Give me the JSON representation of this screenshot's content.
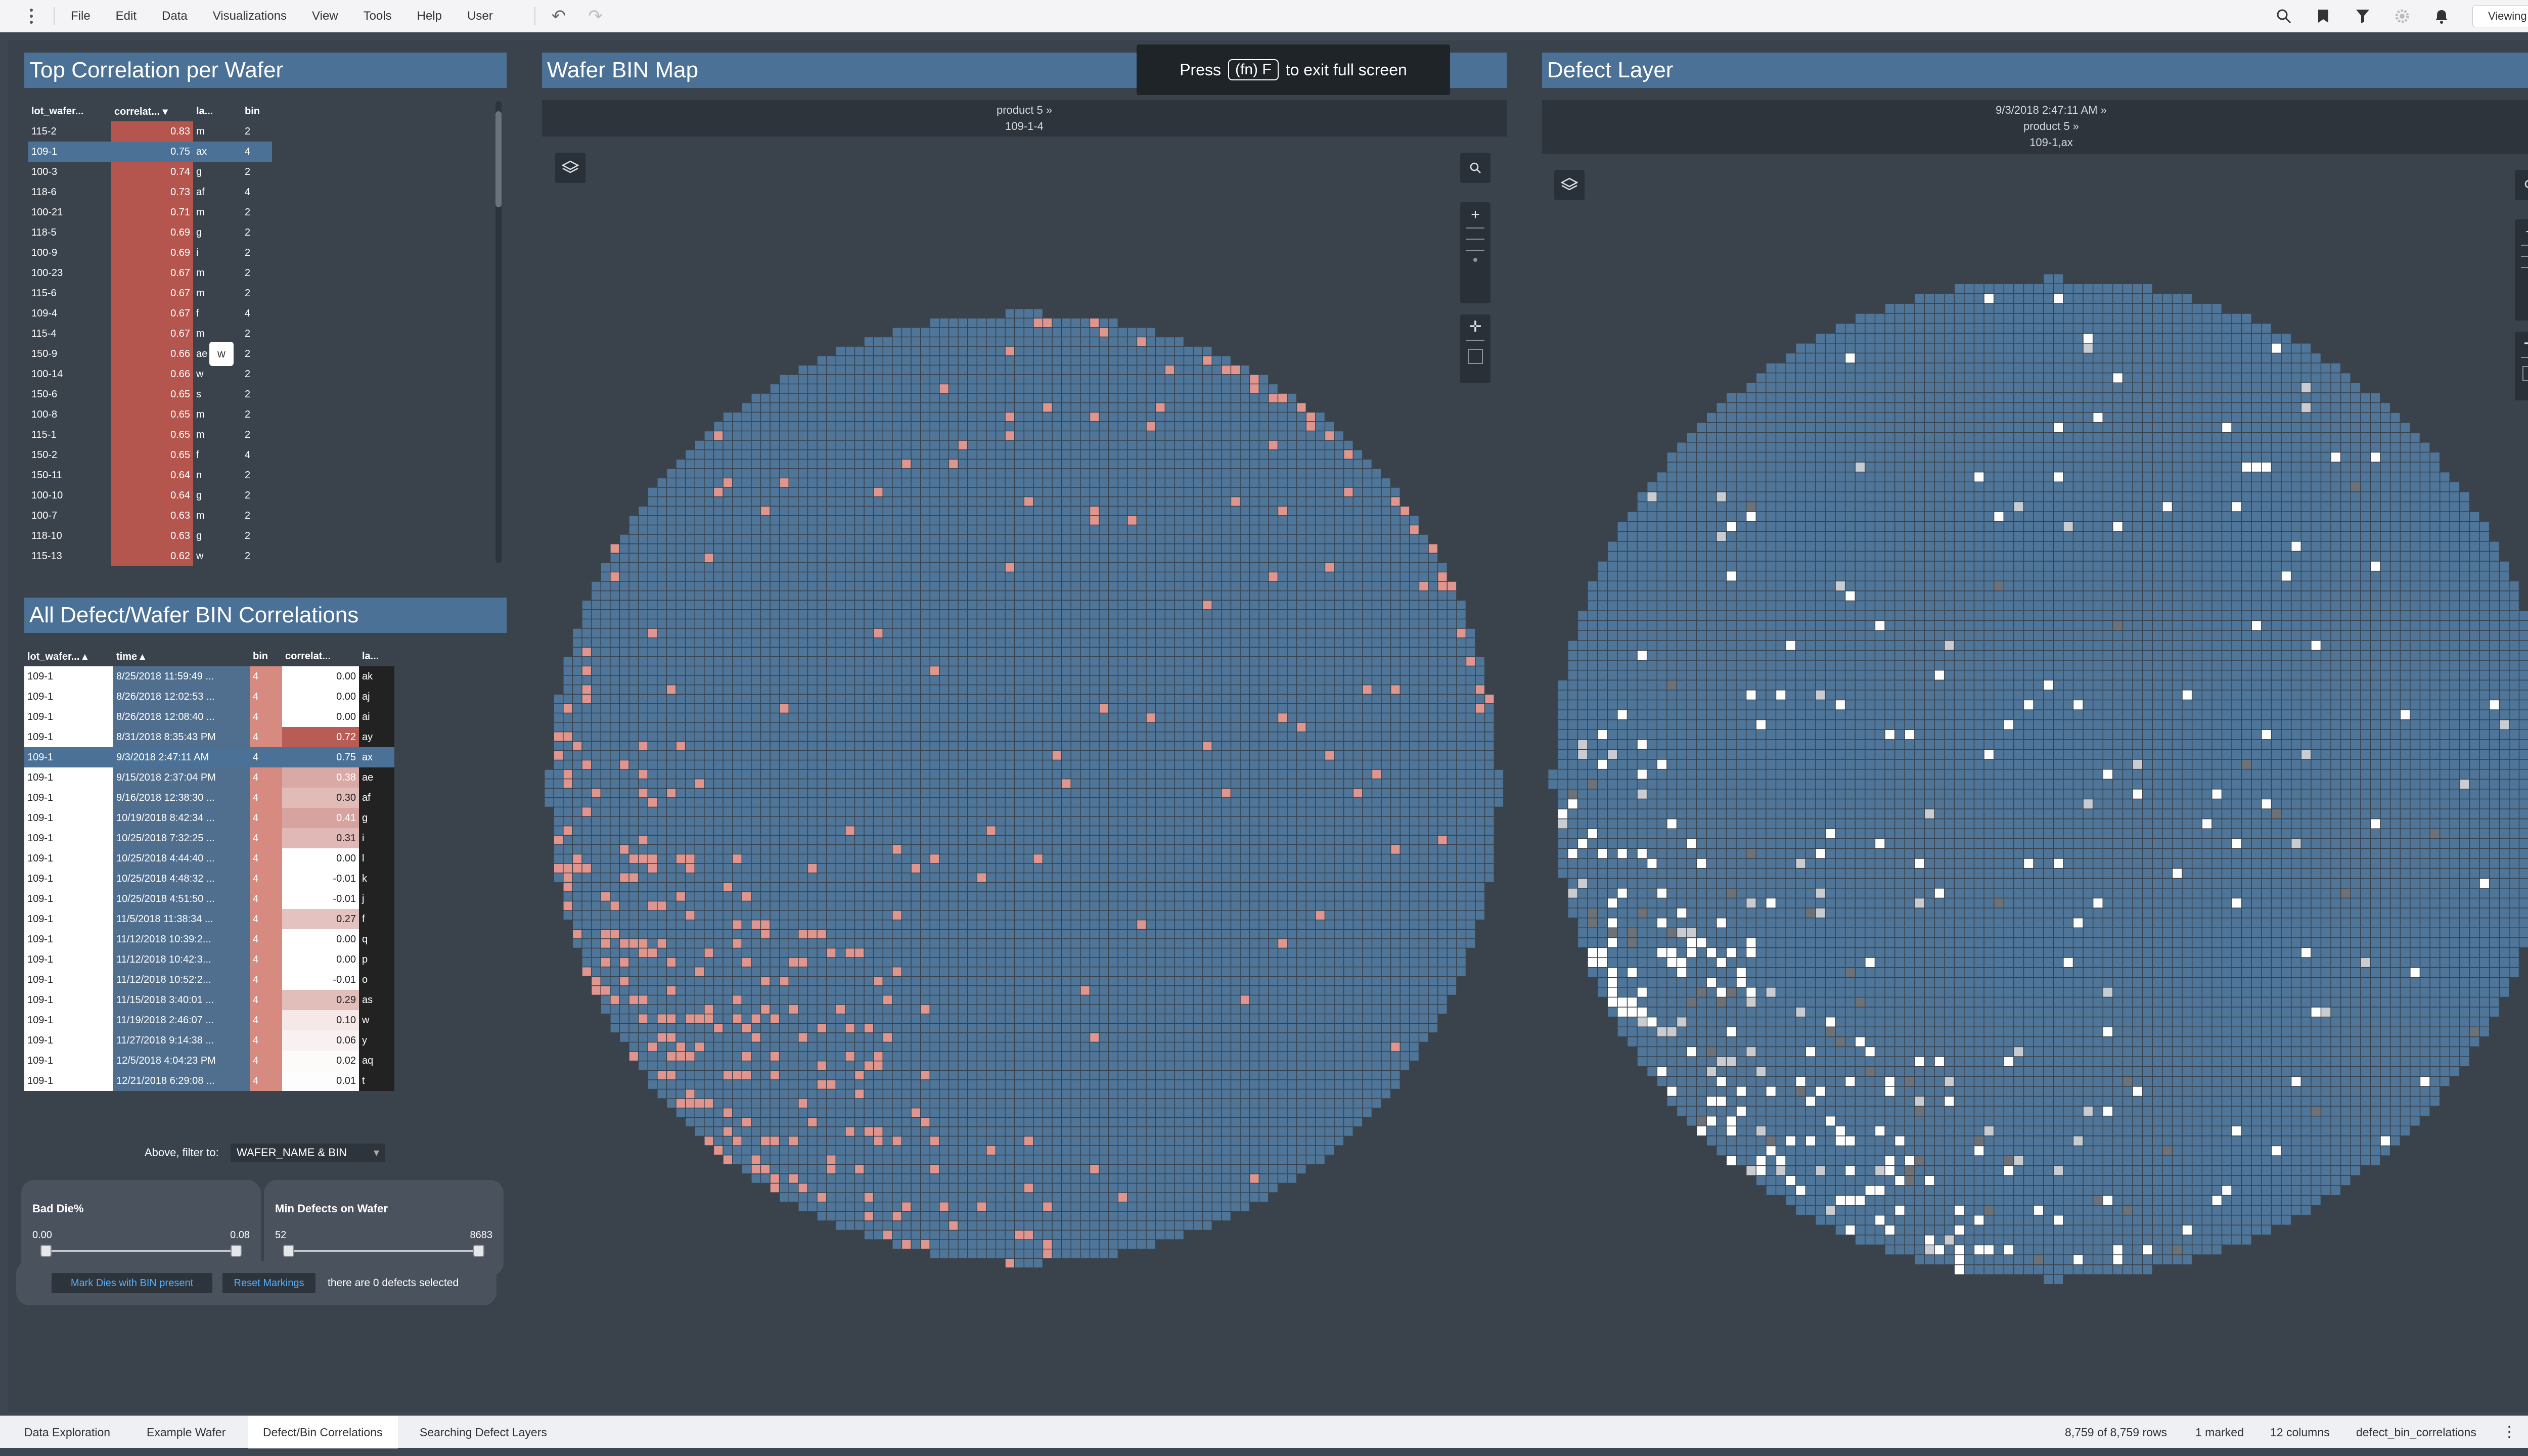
{
  "menu": [
    "File",
    "Edit",
    "Data",
    "Visualizations",
    "View",
    "Tools",
    "Help",
    "User"
  ],
  "mode_label": "Viewing",
  "tooltip": {
    "press": "Press",
    "key": "(fn) F",
    "rest": "to exit full screen"
  },
  "panels": {
    "top_corr_title": "Top Correlation per Wafer",
    "all_corr_title": "All Defect/Wafer BIN Correlations",
    "wafer_bin_title": "Wafer BIN Map",
    "defect_title": "Defect Layer"
  },
  "top_corr": {
    "headers": [
      "lot_wafer...",
      "correlat... ▾",
      "la...",
      "bin"
    ],
    "rows": [
      {
        "lot": "115-2",
        "corr": "0.83",
        "lab": "m",
        "bin": "2"
      },
      {
        "lot": "109-1",
        "corr": "0.75",
        "lab": "ax",
        "bin": "4"
      },
      {
        "lot": "100-3",
        "corr": "0.74",
        "lab": "g",
        "bin": "2"
      },
      {
        "lot": "118-6",
        "corr": "0.73",
        "lab": "af",
        "bin": "4"
      },
      {
        "lot": "100-21",
        "corr": "0.71",
        "lab": "m",
        "bin": "2"
      },
      {
        "lot": "118-5",
        "corr": "0.69",
        "lab": "g",
        "bin": "2"
      },
      {
        "lot": "100-9",
        "corr": "0.69",
        "lab": "i",
        "bin": "2"
      },
      {
        "lot": "100-23",
        "corr": "0.67",
        "lab": "m",
        "bin": "2"
      },
      {
        "lot": "115-6",
        "corr": "0.67",
        "lab": "m",
        "bin": "2"
      },
      {
        "lot": "109-4",
        "corr": "0.67",
        "lab": "f",
        "bin": "4"
      },
      {
        "lot": "115-4",
        "corr": "0.67",
        "lab": "m",
        "bin": "2"
      },
      {
        "lot": "150-9",
        "corr": "0.66",
        "lab": "ae",
        "bin": "2"
      },
      {
        "lot": "100-14",
        "corr": "0.66",
        "lab": "w",
        "bin": "2"
      },
      {
        "lot": "150-6",
        "corr": "0.65",
        "lab": "s",
        "bin": "2"
      },
      {
        "lot": "100-8",
        "corr": "0.65",
        "lab": "m",
        "bin": "2"
      },
      {
        "lot": "115-1",
        "corr": "0.65",
        "lab": "m",
        "bin": "2"
      },
      {
        "lot": "150-2",
        "corr": "0.65",
        "lab": "f",
        "bin": "4"
      },
      {
        "lot": "150-11",
        "corr": "0.64",
        "lab": "n",
        "bin": "2"
      },
      {
        "lot": "100-10",
        "corr": "0.64",
        "lab": "g",
        "bin": "2"
      },
      {
        "lot": "100-7",
        "corr": "0.63",
        "lab": "m",
        "bin": "2"
      },
      {
        "lot": "118-10",
        "corr": "0.63",
        "lab": "g",
        "bin": "2"
      },
      {
        "lot": "115-13",
        "corr": "0.62",
        "lab": "w",
        "bin": "2"
      }
    ],
    "hover_chip": "w"
  },
  "all_corr": {
    "headers": [
      "lot_wafer... ▴",
      "time ▴",
      "bin",
      "correlat...",
      "la..."
    ],
    "rows": [
      {
        "lot": "109-1",
        "time": "8/25/2018 11:59:49 ...",
        "bin": "4",
        "corr": "0.00",
        "lab": "ak"
      },
      {
        "lot": "109-1",
        "time": "8/26/2018 12:02:53 ...",
        "bin": "4",
        "corr": "0.00",
        "lab": "aj"
      },
      {
        "lot": "109-1",
        "time": "8/26/2018 12:08:40 ...",
        "bin": "4",
        "corr": "0.00",
        "lab": "ai"
      },
      {
        "lot": "109-1",
        "time": "8/31/2018 8:35:43 PM",
        "bin": "4",
        "corr": "0.72",
        "lab": "ay"
      },
      {
        "lot": "109-1",
        "time": "9/3/2018 2:47:11 AM",
        "bin": "4",
        "corr": "0.75",
        "lab": "ax"
      },
      {
        "lot": "109-1",
        "time": "9/15/2018 2:37:04 PM",
        "bin": "4",
        "corr": "0.38",
        "lab": "ae"
      },
      {
        "lot": "109-1",
        "time": "9/16/2018 12:38:30 ...",
        "bin": "4",
        "corr": "0.30",
        "lab": "af"
      },
      {
        "lot": "109-1",
        "time": "10/19/2018 8:42:34 ...",
        "bin": "4",
        "corr": "0.41",
        "lab": "g"
      },
      {
        "lot": "109-1",
        "time": "10/25/2018 7:32:25 ...",
        "bin": "4",
        "corr": "0.31",
        "lab": "i"
      },
      {
        "lot": "109-1",
        "time": "10/25/2018 4:44:40 ...",
        "bin": "4",
        "corr": "0.00",
        "lab": "l"
      },
      {
        "lot": "109-1",
        "time": "10/25/2018 4:48:32 ...",
        "bin": "4",
        "corr": "-0.01",
        "lab": "k"
      },
      {
        "lot": "109-1",
        "time": "10/25/2018 4:51:50 ...",
        "bin": "4",
        "corr": "-0.01",
        "lab": "j"
      },
      {
        "lot": "109-1",
        "time": "11/5/2018 11:38:34 ...",
        "bin": "4",
        "corr": "0.27",
        "lab": "f"
      },
      {
        "lot": "109-1",
        "time": "11/12/2018 10:39:2...",
        "bin": "4",
        "corr": "0.00",
        "lab": "q"
      },
      {
        "lot": "109-1",
        "time": "11/12/2018 10:42:3...",
        "bin": "4",
        "corr": "0.00",
        "lab": "p"
      },
      {
        "lot": "109-1",
        "time": "11/12/2018 10:52:2...",
        "bin": "4",
        "corr": "-0.01",
        "lab": "o"
      },
      {
        "lot": "109-1",
        "time": "11/15/2018 3:40:01 ...",
        "bin": "4",
        "corr": "0.29",
        "lab": "as"
      },
      {
        "lot": "109-1",
        "time": "11/19/2018 2:46:07 ...",
        "bin": "4",
        "corr": "0.10",
        "lab": "w"
      },
      {
        "lot": "109-1",
        "time": "11/27/2018 9:14:38 ...",
        "bin": "4",
        "corr": "0.06",
        "lab": "y"
      },
      {
        "lot": "109-1",
        "time": "12/5/2018 4:04:23 PM",
        "bin": "4",
        "corr": "0.02",
        "lab": "aq"
      },
      {
        "lot": "109-1",
        "time": "12/21/2018 6:29:08 ...",
        "bin": "4",
        "corr": "0.01",
        "lab": "t"
      }
    ]
  },
  "filter": {
    "label": "Above, filter to:",
    "value": "WAFER_NAME & BIN"
  },
  "sliders": [
    {
      "title": "Bad Die%",
      "min": "0.00",
      "max": "0.08"
    },
    {
      "title": "Min Defects on Wafer",
      "min": "52",
      "max": "8683"
    }
  ],
  "buttons": {
    "mark": "Mark Dies with BIN present",
    "reset": "Reset Markings",
    "status": "there are 0 defects selected"
  },
  "wafer_bin": {
    "sub1": "product 5 »",
    "sub2": "109-1-4"
  },
  "defect": {
    "sub1": "9/3/2018 2:47:11 AM »",
    "sub2": "product 5 »",
    "sub3": "109-1,ax"
  },
  "bottom": {
    "tabs": [
      "Data Exploration",
      "Example Wafer",
      "Defect/Bin Correlations",
      "Searching Defect Layers"
    ],
    "rows": "8,759 of 8,759 rows",
    "marked": "1 marked",
    "cols": "12 columns",
    "table": "defect_bin_correlations"
  },
  "colors": {
    "accent": "#4c7196",
    "die": "#4f7598",
    "bin_hit": "#e0968e",
    "corr_high": "#b4564e",
    "link": "#52b0ff"
  },
  "icons": [
    "kebab-icon",
    "undo-icon",
    "redo-icon",
    "search-icon",
    "bookmark-icon",
    "filter-icon",
    "gear-icon",
    "bell-icon",
    "layers-icon",
    "zoom-icon",
    "pan-icon",
    "globe-icon"
  ]
}
